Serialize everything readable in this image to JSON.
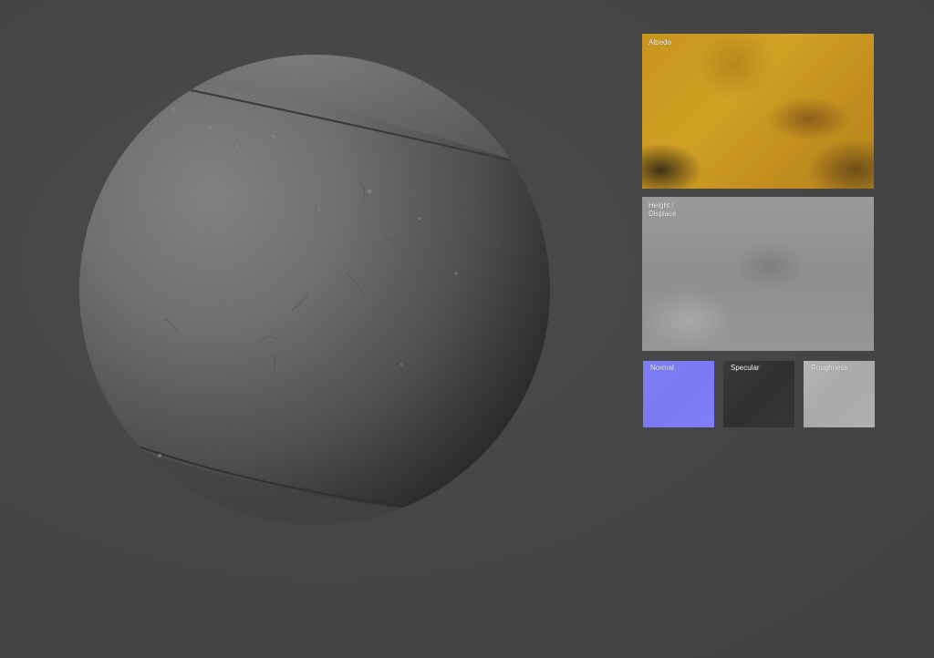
{
  "maps": {
    "albedo": {
      "label": "Albedo"
    },
    "height": {
      "label": "Height /\nDisplace"
    },
    "normal": {
      "label": "Normal"
    },
    "specular": {
      "label": "Specular"
    },
    "roughness": {
      "label": "Roughness"
    }
  },
  "colors": {
    "background": "#464646",
    "albedo": "#c9951f",
    "normal": "#7f7ff7",
    "specular": "#333333",
    "roughness": "#aeaeae",
    "height": "#939393"
  }
}
